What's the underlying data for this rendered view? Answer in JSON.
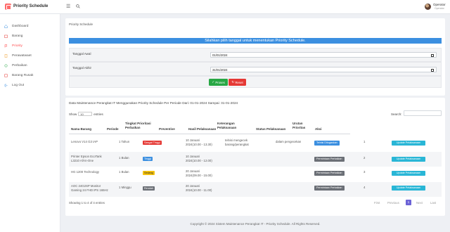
{
  "app": {
    "brand": "Priority Schedule"
  },
  "user": {
    "name": "Operator",
    "role": "Operator"
  },
  "sidebar": {
    "items": [
      {
        "label": "Dashboard",
        "icon": "home-icon",
        "active": false
      },
      {
        "label": "Barang",
        "icon": "box-icon",
        "active": false
      },
      {
        "label": "Priority",
        "icon": "flag-icon",
        "active": true
      },
      {
        "label": "Perawatwaet",
        "icon": "document-icon",
        "active": false
      },
      {
        "label": "Perbaikan",
        "icon": "wrench-icon",
        "active": false
      },
      {
        "label": "Barang Rusak",
        "icon": "alert-icon",
        "active": false
      },
      {
        "label": "Log Out",
        "icon": "logout-icon",
        "active": false
      }
    ]
  },
  "filter": {
    "breadcrumb": "Priority Schedule",
    "info": "Silahkan pilih tanggal untuk menentukan Priority Schedule.",
    "start_label": "Tanggal Awal",
    "start_value": "01/01/2024",
    "end_label": "Tanggal Akhir",
    "end_value": "31/01/2024",
    "proses_label": "Proses",
    "reset_label": "Reset"
  },
  "table": {
    "period_title": "Data Maintenance Perangkat IT Menggunakan Priority Schedule Per Periode Dari: 01-01-2024 Sampai: 31-01-2024",
    "show_label": "Show",
    "entries_value": "10",
    "entries_label": "entries",
    "search_label": "Search:",
    "headers": {
      "nama_barang": "Nama Barang",
      "periode": "Periode",
      "tingkat": "Tingkat Prioritasi Perbaikan",
      "preventive": "Preventive",
      "hasil": "Hasil Pelaksanaan",
      "keterangan": "Keterangan Pelaksanaan",
      "status": "Status Pelaksanaan",
      "urutan": "Urutan Prioritas",
      "aksi": "Aksi"
    },
    "rows": [
      {
        "nama_barang": "Lenovo V14 G3 IAP",
        "periode": "1 Tahun",
        "tingkat": "Sangat Tinggi",
        "tingkat_color": "red",
        "preventive": "",
        "hasil": "10 Januari 2024(10.00 - 13.30)",
        "keterangan": "telnisi mengecek barang/perangkat",
        "status_pelaksanaan": "dalam pengecekan",
        "status_label": "Telnisi Ditugaskan",
        "status_color": "blue",
        "urutan": "1",
        "update_label": "Update Pelaksanaan"
      },
      {
        "nama_barang": "Printer Epson EcoTank L3210 All-in-One",
        "periode": "1 Bulan",
        "tingkat": "Tinggi",
        "tingkat_color": "blue",
        "preventive": "",
        "hasil": "10 Januari 2024(10.00 - 12.00)",
        "keterangan": "",
        "status_pelaksanaan": "",
        "status_label": "Permintaan Perbaikan",
        "status_color": "gray",
        "urutan": "2",
        "update_label": "Update Pelaksanaan"
      },
      {
        "nama_barang": "HG 1200 Technology",
        "periode": "1 Bulan",
        "tingkat": "Sedang",
        "tingkat_color": "yellow",
        "preventive": "",
        "hasil": "20 Januari 2024(09.00 - 15.00)",
        "keterangan": "",
        "status_pelaksanaan": "",
        "status_label": "Permintaan Perbaikan",
        "status_color": "gray",
        "urutan": "3",
        "update_label": "Update Pelaksanaan"
      },
      {
        "nama_barang": "AOC 24G2SP Monitor Gaming 24 FHD IPS 165Hz",
        "periode": "1 Minggu",
        "tingkat": "Rendah",
        "tingkat_color": "gray",
        "preventive": "",
        "hasil": "20 Januari 2024(10.00 - 11.00)",
        "keterangan": "",
        "status_pelaksanaan": "",
        "status_label": "Permintaan Perbaikan",
        "status_color": "gray",
        "urutan": "4",
        "update_label": "Update Pelaksanaan"
      }
    ],
    "showing": "Showing 1 to 4 of 4 entries",
    "pagination": {
      "first": "First",
      "previous": "Previous",
      "current": "1",
      "next": "Next",
      "last": "Last"
    }
  },
  "footer": {
    "text": "Copyright © 2024 Sistem Maintenance Perangkat IT - Priority Schedule. All Rights Reserved."
  },
  "colors": {
    "accent_red": "#ff4d4f",
    "info_blue": "#3b8fe0",
    "success_green": "#28a745",
    "danger_red": "#e53935",
    "update_cyan": "#29b6d6",
    "page_active": "#6c63d6"
  }
}
